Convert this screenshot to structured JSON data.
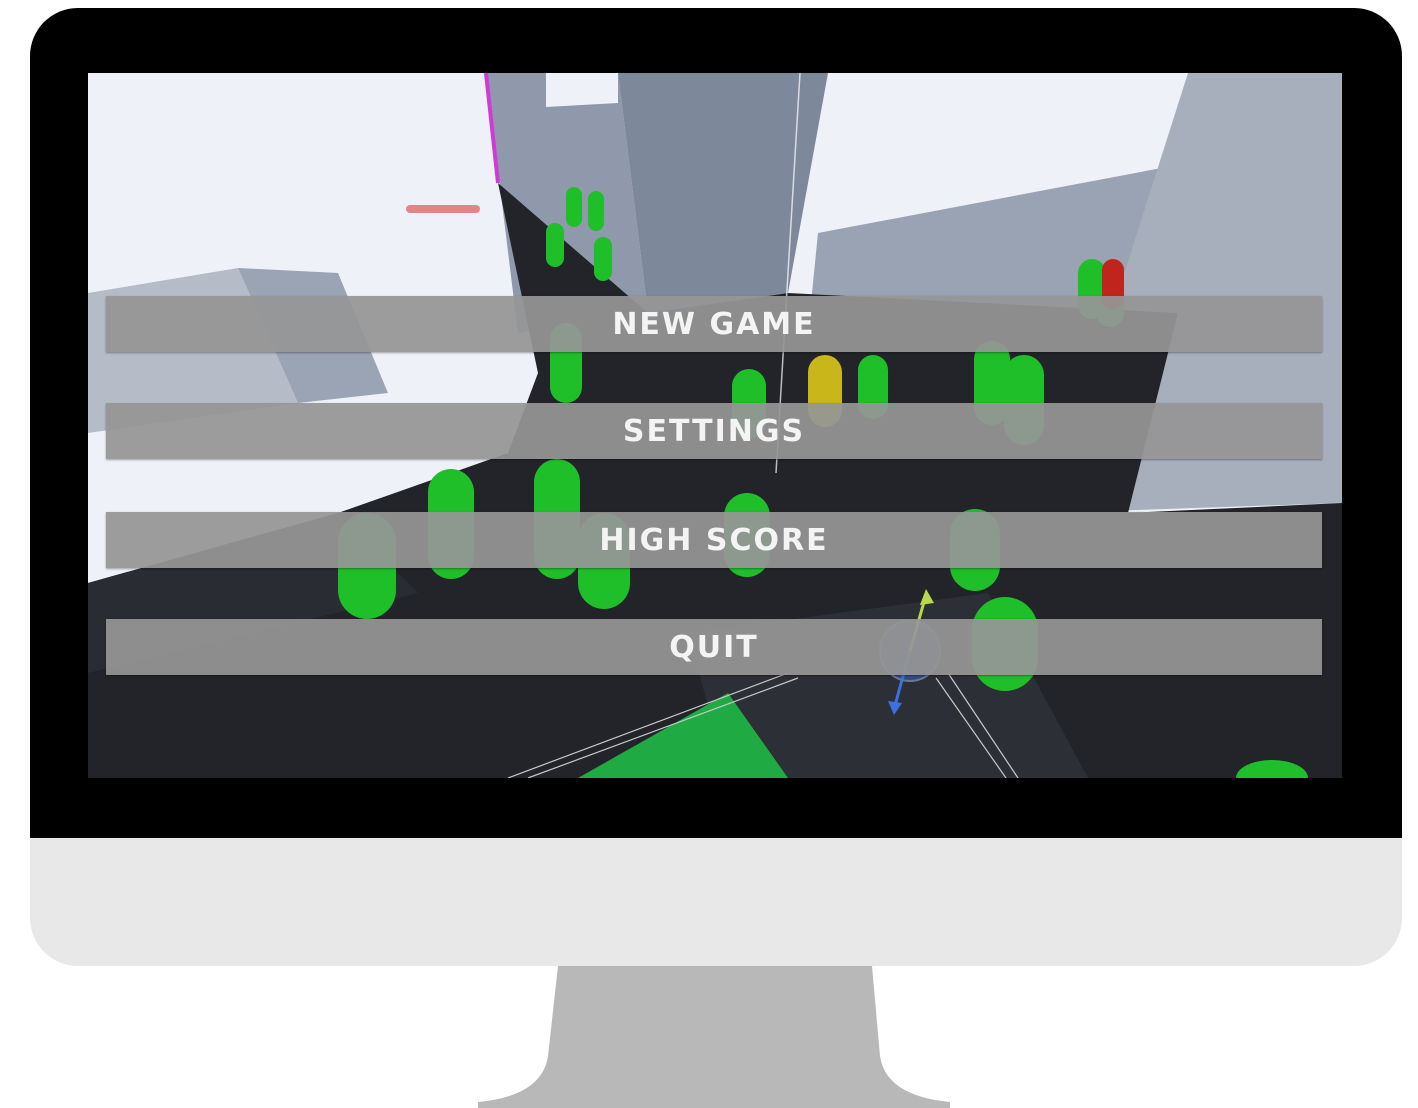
{
  "menu": {
    "new_game": "NEW GAME",
    "settings": "SETTINGS",
    "high_score": "HIGH SCORE",
    "quit": "QUIT"
  },
  "colors": {
    "menu_button_bg": "#969696",
    "menu_button_text": "#f4f4f4",
    "capsule_green": "#1fbf2a",
    "capsule_yellow": "#c9b61a",
    "floor_dark": "#22242a",
    "sky": "#eef1f7",
    "wall": "#8d97a8"
  }
}
